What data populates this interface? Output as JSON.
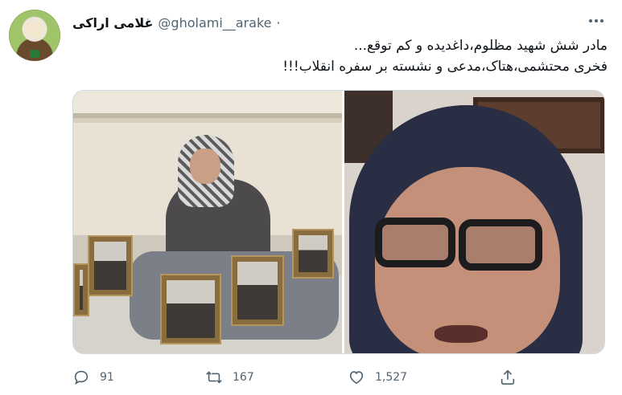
{
  "author": {
    "display_name": "غلامی اراکی",
    "handle": "@gholami__arake",
    "separator": "·"
  },
  "tweet": {
    "line1": "مادر شش شهید مظلوم،داغدیده و کم توقع...",
    "line2": "فخری محتشمی،هتاک،مدعی و نشسته بر سفره انقلاب!!!"
  },
  "actions": {
    "replies": "91",
    "retweets": "167",
    "likes": "1,527"
  },
  "icons": [
    "more-icon",
    "reply-icon",
    "retweet-icon",
    "like-icon",
    "share-icon"
  ]
}
